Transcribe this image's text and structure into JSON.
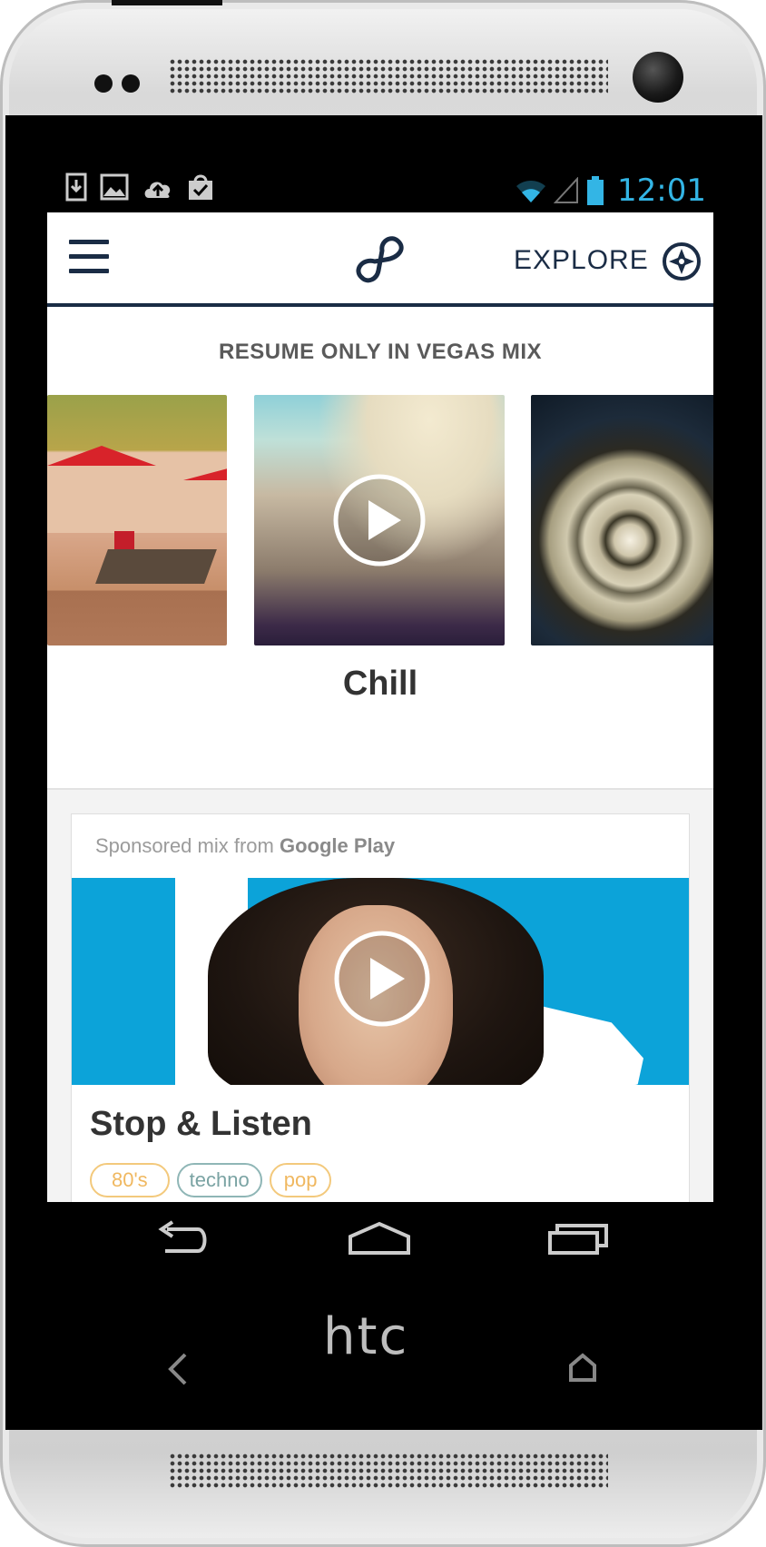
{
  "status_bar": {
    "time": "12:01",
    "icons": [
      "download-icon",
      "image-icon",
      "cloud-upload-icon",
      "shopping-bag-check-icon",
      "wifi-icon",
      "signal-icon",
      "battery-icon"
    ],
    "clock_color": "#33b5e5"
  },
  "app_bar": {
    "menu_icon": "hamburger-menu-icon",
    "logo_icon": "8tracks-infinity-logo",
    "explore_label": "EXPLORE",
    "explore_icon": "compass-icon"
  },
  "resume": {
    "heading": "RESUME ONLY IN VEGAS MIX",
    "current_mix_title": "Chill"
  },
  "sponsored_card": {
    "prefix": "Sponsored mix from",
    "sponsor": "Google Play",
    "title": "Stop & Listen",
    "tags": [
      "80's",
      "techno",
      "pop"
    ]
  },
  "nav_bar": {
    "buttons": [
      "back-icon",
      "home-icon",
      "recent-apps-icon"
    ]
  },
  "device": {
    "brand": "htc"
  },
  "colors": {
    "brand_navy": "#1a2c45",
    "google_play_blue": "#0ca3d9",
    "tag_orange": "#f0b860",
    "tag_teal": "#7aa3a3"
  }
}
